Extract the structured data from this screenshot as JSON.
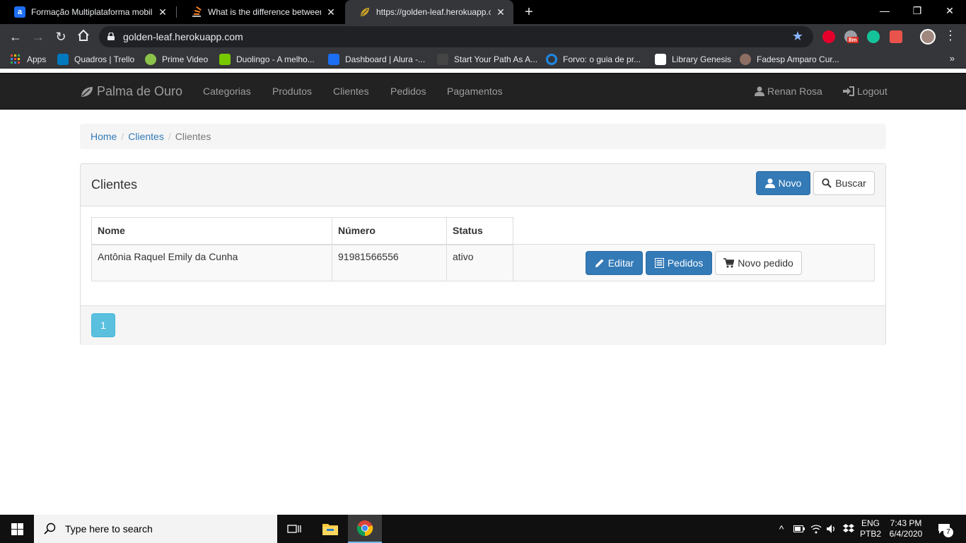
{
  "browser": {
    "tabs": [
      {
        "title": "Formação Multiplataforma mobil",
        "favicon": "alura-icon",
        "active": false
      },
      {
        "title": "What is the difference between lo",
        "favicon": "stackoverflow-icon",
        "active": false
      },
      {
        "title": "https://golden-leaf.herokuapp.co",
        "favicon": "leaf-icon",
        "active": true
      }
    ],
    "new_tab_label": "+",
    "url": "golden-leaf.herokuapp.com",
    "bookmarks": [
      {
        "label": "Apps",
        "icon": "apps-grid-icon"
      },
      {
        "label": "Quadros | Trello",
        "icon": "trello-icon"
      },
      {
        "label": "Prime Video",
        "icon": "prime-video-icon"
      },
      {
        "label": "Duolingo - A melho...",
        "icon": "duolingo-icon"
      },
      {
        "label": "Dashboard | Alura -...",
        "icon": "alura-icon"
      },
      {
        "label": "Start Your Path As A...",
        "icon": "path-icon"
      },
      {
        "label": "Forvo: o guia de pr...",
        "icon": "forvo-icon"
      },
      {
        "label": "Library Genesis",
        "icon": "library-icon"
      },
      {
        "label": "Fadesp Amparo Cur...",
        "icon": "fadesp-icon"
      }
    ],
    "bookmarks_more": "»",
    "extension_badge": "8m"
  },
  "navbar": {
    "brand": "Palma de Ouro",
    "links": [
      "Categorias",
      "Produtos",
      "Clientes",
      "Pedidos",
      "Pagamentos"
    ],
    "user": "Renan Rosa",
    "logout": "Logout"
  },
  "breadcrumb": {
    "items": [
      "Home",
      "Clientes"
    ],
    "separator": "/",
    "current": "Clientes"
  },
  "panel": {
    "title": "Clientes",
    "new_button": "Novo",
    "search_button": "Buscar"
  },
  "table": {
    "headers": [
      "Nome",
      "Número",
      "Status"
    ],
    "rows": [
      {
        "nome": "Antônia Raquel Emily da Cunha",
        "numero": "91981566556",
        "status": "ativo"
      }
    ],
    "row_actions": {
      "edit": "Editar",
      "orders": "Pedidos",
      "new_order": "Novo pedido"
    }
  },
  "pagination": {
    "current_page": "1"
  },
  "taskbar": {
    "search_placeholder": "Type here to search",
    "language_top": "ENG",
    "language_bottom": "PTB2",
    "time": "7:43 PM",
    "date": "6/4/2020",
    "notification_count": "7"
  },
  "colors": {
    "navbar_bg": "#222222",
    "primary": "#337ab7",
    "info": "#5bc0de",
    "link": "#337ab7"
  }
}
